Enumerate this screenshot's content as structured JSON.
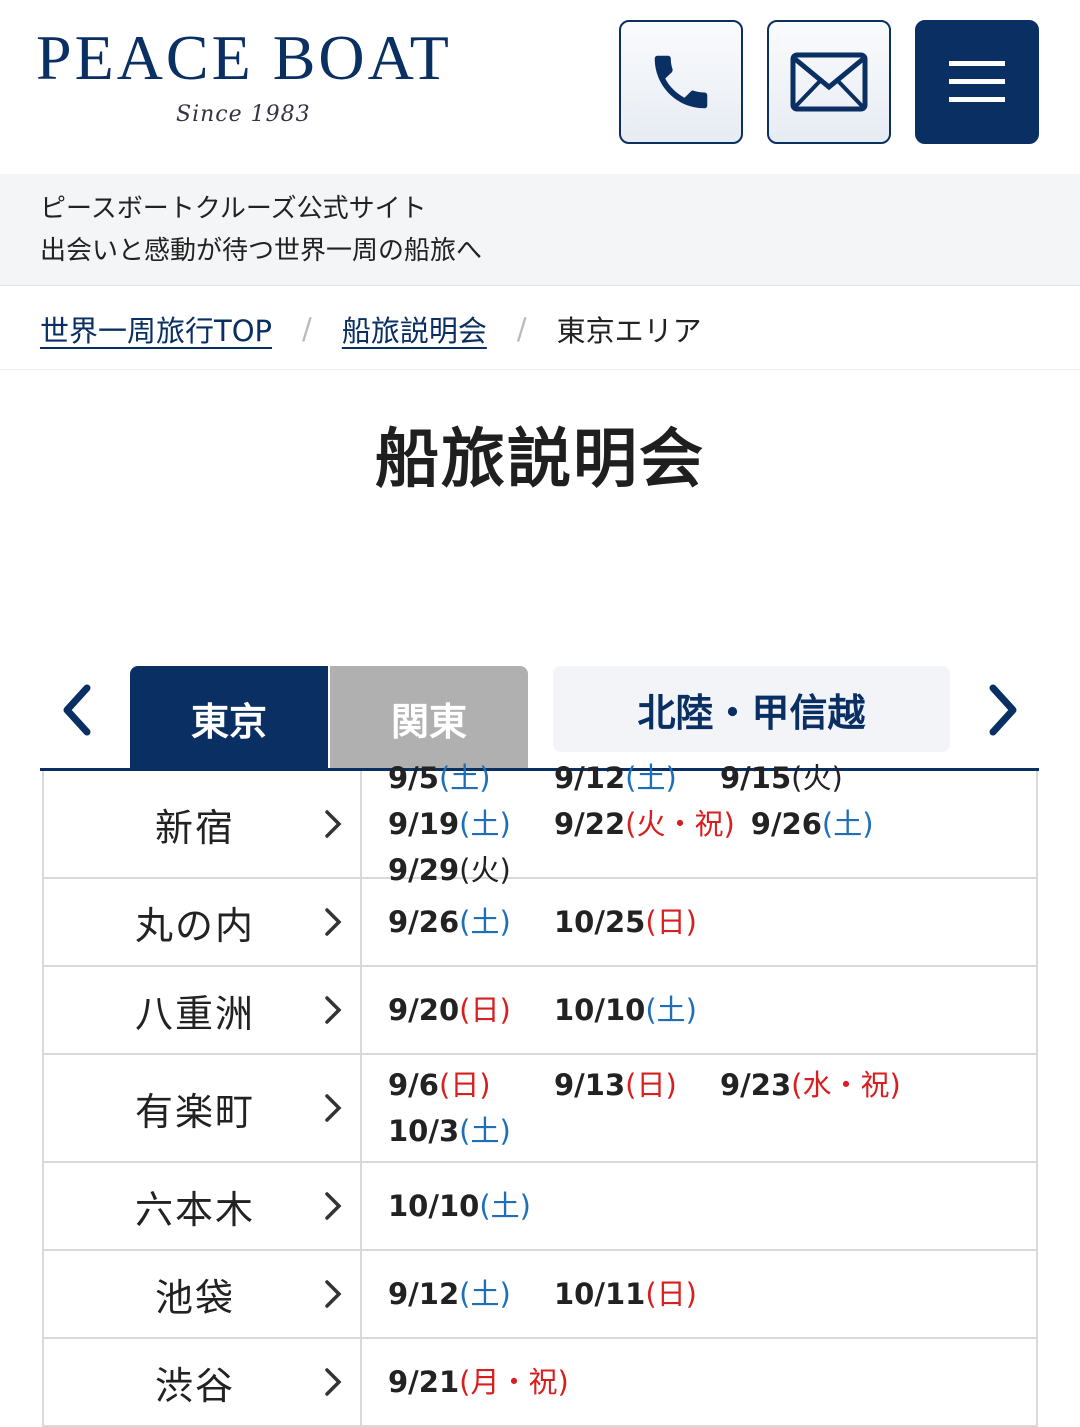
{
  "header": {
    "logo_text": "PEACE BOAT",
    "logo_since": "Since 1983",
    "phone_icon": "phone-icon",
    "mail_icon": "mail-icon",
    "menu_icon": "menu-icon",
    "brand_color": "#0a2f62"
  },
  "tagline": {
    "line1": "ピースボートクルーズ公式サイト",
    "line2": "出会いと感動が待つ世界一周の船旅へ"
  },
  "breadcrumb": {
    "items": [
      "世界一周旅行TOP",
      "船旅説明会",
      "東京エリア"
    ],
    "separator": "/"
  },
  "page": {
    "title": "船旅説明会"
  },
  "tabs": {
    "items": [
      "東京",
      "関東",
      "北陸・甲信越"
    ],
    "active": "東京"
  },
  "table": {
    "rows": [
      {
        "location": "新宿",
        "dates": [
          {
            "date": "9/5",
            "day": "(土)",
            "type": "sat"
          },
          {
            "date": "9/12",
            "day": "(土)",
            "type": "sat"
          },
          {
            "date": "9/15",
            "day": "(火)",
            "type": "wk"
          },
          {
            "date": "9/19",
            "day": "(土)",
            "type": "sat"
          },
          {
            "date": "9/22",
            "day": "(火・祝)",
            "type": "sun"
          },
          {
            "date": "9/26",
            "day": "(土)",
            "type": "sat"
          },
          {
            "date": "9/29",
            "day": "(火)",
            "type": "wk"
          }
        ]
      },
      {
        "location": "丸の内",
        "dates": [
          {
            "date": "9/26",
            "day": "(土)",
            "type": "sat"
          },
          {
            "date": "10/25",
            "day": "(日)",
            "type": "sun"
          }
        ]
      },
      {
        "location": "八重洲",
        "dates": [
          {
            "date": "9/20",
            "day": "(日)",
            "type": "sun"
          },
          {
            "date": "10/10",
            "day": "(土)",
            "type": "sat"
          }
        ]
      },
      {
        "location": "有楽町",
        "dates": [
          {
            "date": "9/6",
            "day": "(日)",
            "type": "sun"
          },
          {
            "date": "9/13",
            "day": "(日)",
            "type": "sun"
          },
          {
            "date": "9/23",
            "day": "(水・祝)",
            "type": "sun"
          },
          {
            "date": "10/3",
            "day": "(土)",
            "type": "sat"
          }
        ]
      },
      {
        "location": "六本木",
        "dates": [
          {
            "date": "10/10",
            "day": "(土)",
            "type": "sat"
          }
        ]
      },
      {
        "location": "池袋",
        "dates": [
          {
            "date": "9/12",
            "day": "(土)",
            "type": "sat"
          },
          {
            "date": "10/11",
            "day": "(日)",
            "type": "sun"
          }
        ]
      },
      {
        "location": "渋谷",
        "dates": [
          {
            "date": "9/21",
            "day": "(月・祝)",
            "type": "sun"
          }
        ]
      }
    ]
  },
  "colors": {
    "saturday": "#1f6fb8",
    "sunday_holiday": "#d81f1f",
    "weekday": "#222222",
    "tab_inactive": "#b0b0b0"
  }
}
